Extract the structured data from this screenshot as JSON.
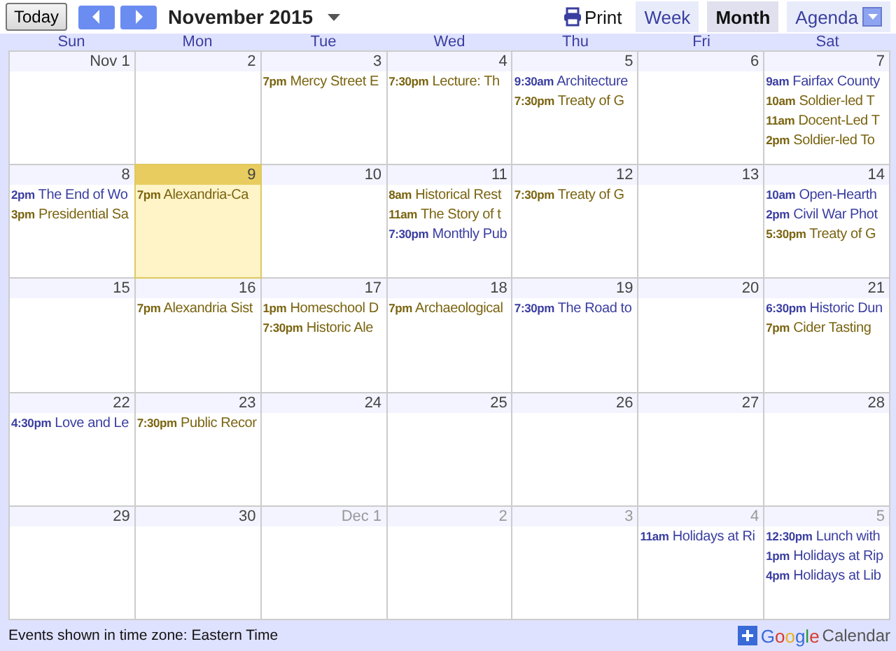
{
  "toolbar": {
    "today": "Today",
    "title": "November 2015",
    "print": "Print",
    "views": [
      {
        "label": "Week",
        "selected": false
      },
      {
        "label": "Month",
        "selected": true
      },
      {
        "label": "Agenda",
        "selected": false
      }
    ]
  },
  "weekdays": [
    "Sun",
    "Mon",
    "Tue",
    "Wed",
    "Thu",
    "Fri",
    "Sat"
  ],
  "weeks": [
    [
      {
        "label": "Nov 1",
        "other_month": false,
        "today": false
      },
      {
        "label": "2",
        "other_month": false,
        "today": false
      },
      {
        "label": "3",
        "other_month": false,
        "today": false,
        "events": [
          {
            "time": "7pm",
            "title": "Mercy Street E",
            "color": "#7a6410"
          }
        ]
      },
      {
        "label": "4",
        "other_month": false,
        "today": false,
        "events": [
          {
            "time": "7:30pm",
            "title": "Lecture: Th",
            "color": "#7a6410"
          }
        ]
      },
      {
        "label": "5",
        "other_month": false,
        "today": false,
        "events": [
          {
            "time": "9:30am",
            "title": "Architecture",
            "color": "#3a3ea0"
          },
          {
            "time": "7:30pm",
            "title": "Treaty of G",
            "color": "#7a6410"
          }
        ]
      },
      {
        "label": "6",
        "other_month": false,
        "today": false
      },
      {
        "label": "7",
        "other_month": false,
        "today": false,
        "events": [
          {
            "time": "9am",
            "title": "Fairfax County",
            "color": "#3a3ea0"
          },
          {
            "time": "10am",
            "title": "Soldier-led T",
            "color": "#7a6410"
          },
          {
            "time": "11am",
            "title": "Docent-Led T",
            "color": "#7a6410"
          },
          {
            "time": "2pm",
            "title": "Soldier-led To",
            "color": "#7a6410"
          }
        ]
      }
    ],
    [
      {
        "label": "8",
        "other_month": false,
        "today": false,
        "events": [
          {
            "time": "2pm",
            "title": "The End of Wo",
            "color": "#3a3ea0"
          },
          {
            "time": "3pm",
            "title": "Presidential Sa",
            "color": "#7a6410"
          }
        ]
      },
      {
        "label": "9",
        "other_month": false,
        "today": true,
        "events": [
          {
            "time": "7pm",
            "title": "Alexandria-Ca",
            "color": "#7a6410"
          }
        ]
      },
      {
        "label": "10",
        "other_month": false,
        "today": false
      },
      {
        "label": "11",
        "other_month": false,
        "today": false,
        "events": [
          {
            "time": "8am",
            "title": "Historical Rest",
            "color": "#7a6410"
          },
          {
            "time": "11am",
            "title": "The Story of t",
            "color": "#7a6410"
          },
          {
            "time": "7:30pm",
            "title": "Monthly Pub",
            "color": "#3a3ea0"
          }
        ]
      },
      {
        "label": "12",
        "other_month": false,
        "today": false,
        "events": [
          {
            "time": "7:30pm",
            "title": "Treaty of G",
            "color": "#7a6410"
          }
        ]
      },
      {
        "label": "13",
        "other_month": false,
        "today": false
      },
      {
        "label": "14",
        "other_month": false,
        "today": false,
        "events": [
          {
            "time": "10am",
            "title": "Open-Hearth",
            "color": "#3a3ea0"
          },
          {
            "time": "2pm",
            "title": "Civil War Phot",
            "color": "#3a3ea0"
          },
          {
            "time": "5:30pm",
            "title": "Treaty of G",
            "color": "#7a6410"
          }
        ]
      }
    ],
    [
      {
        "label": "15",
        "other_month": false,
        "today": false
      },
      {
        "label": "16",
        "other_month": false,
        "today": false,
        "events": [
          {
            "time": "7pm",
            "title": "Alexandria Sist",
            "color": "#7a6410"
          }
        ]
      },
      {
        "label": "17",
        "other_month": false,
        "today": false,
        "events": [
          {
            "time": "1pm",
            "title": "Homeschool D",
            "color": "#7a6410"
          },
          {
            "time": "7:30pm",
            "title": "Historic Ale",
            "color": "#7a6410"
          }
        ]
      },
      {
        "label": "18",
        "other_month": false,
        "today": false,
        "events": [
          {
            "time": "7pm",
            "title": "Archaeological",
            "color": "#7a6410"
          }
        ]
      },
      {
        "label": "19",
        "other_month": false,
        "today": false,
        "events": [
          {
            "time": "7:30pm",
            "title": "The Road to",
            "color": "#3a3ea0"
          }
        ]
      },
      {
        "label": "20",
        "other_month": false,
        "today": false
      },
      {
        "label": "21",
        "other_month": false,
        "today": false,
        "events": [
          {
            "time": "6:30pm",
            "title": "Historic Dun",
            "color": "#3a3ea0"
          },
          {
            "time": "7pm",
            "title": "Cider Tasting",
            "color": "#7a6410"
          }
        ]
      }
    ],
    [
      {
        "label": "22",
        "other_month": false,
        "today": false,
        "events": [
          {
            "time": "4:30pm",
            "title": "Love and Le",
            "color": "#3a3ea0"
          }
        ]
      },
      {
        "label": "23",
        "other_month": false,
        "today": false,
        "events": [
          {
            "time": "7:30pm",
            "title": "Public Recor",
            "color": "#7a6410"
          }
        ]
      },
      {
        "label": "24",
        "other_month": false,
        "today": false
      },
      {
        "label": "25",
        "other_month": false,
        "today": false
      },
      {
        "label": "26",
        "other_month": false,
        "today": false
      },
      {
        "label": "27",
        "other_month": false,
        "today": false
      },
      {
        "label": "28",
        "other_month": false,
        "today": false
      }
    ],
    [
      {
        "label": "29",
        "other_month": false,
        "today": false
      },
      {
        "label": "30",
        "other_month": false,
        "today": false
      },
      {
        "label": "Dec 1",
        "other_month": true,
        "today": false
      },
      {
        "label": "2",
        "other_month": true,
        "today": false
      },
      {
        "label": "3",
        "other_month": true,
        "today": false
      },
      {
        "label": "4",
        "other_month": true,
        "today": false,
        "events": [
          {
            "time": "11am",
            "title": "Holidays at Ri",
            "color": "#3a3ea0"
          }
        ]
      },
      {
        "label": "5",
        "other_month": true,
        "today": false,
        "events": [
          {
            "time": "12:30pm",
            "title": "Lunch with",
            "color": "#3a3ea0"
          },
          {
            "time": "1pm",
            "title": "Holidays at Rip",
            "color": "#3a3ea0"
          },
          {
            "time": "4pm",
            "title": "Holidays at Lib",
            "color": "#3a3ea0"
          }
        ]
      }
    ]
  ],
  "footer": {
    "timezone": "Events shown in time zone: Eastern Time",
    "brand": "Google",
    "product": "Calendar"
  }
}
